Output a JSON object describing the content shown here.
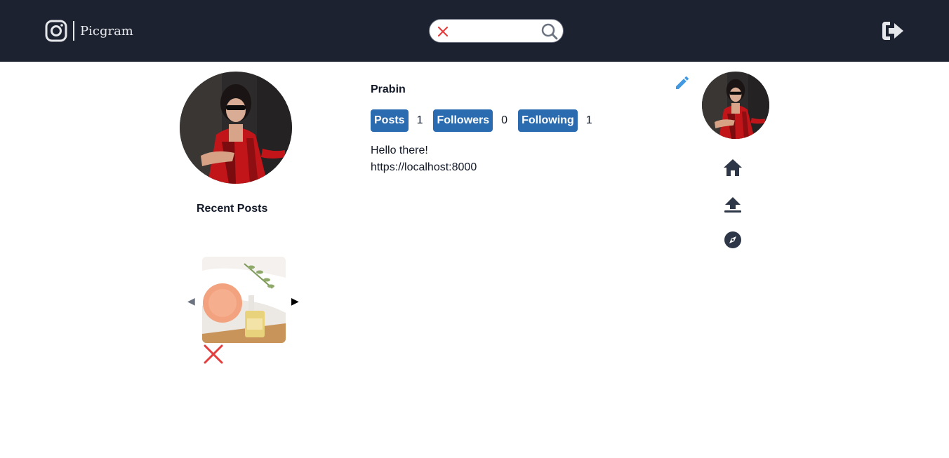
{
  "header": {
    "brand_name": "Picgram",
    "brand_icon": "instagram-logo-icon",
    "search": {
      "placeholder": "",
      "value": ""
    },
    "logout_icon": "logout-icon"
  },
  "profile": {
    "username": "Prabin",
    "stats": {
      "posts_label": "Posts",
      "posts_count": "1",
      "followers_label": "Followers",
      "followers_count": "0",
      "following_label": "Following",
      "following_count": "1"
    },
    "bio_line1": "Hello there!",
    "bio_line2": "https://localhost:8000"
  },
  "recent_posts": {
    "title": "Recent Posts",
    "prev_glyph": "◀",
    "next_glyph": "▶"
  },
  "sidebar": {
    "items": [
      "home-icon",
      "upload-icon",
      "compass-icon"
    ]
  },
  "colors": {
    "header_bg": "#1d2230",
    "accent": "#2b6cb0",
    "danger": "#e53e3e",
    "edit": "#4299e1"
  }
}
